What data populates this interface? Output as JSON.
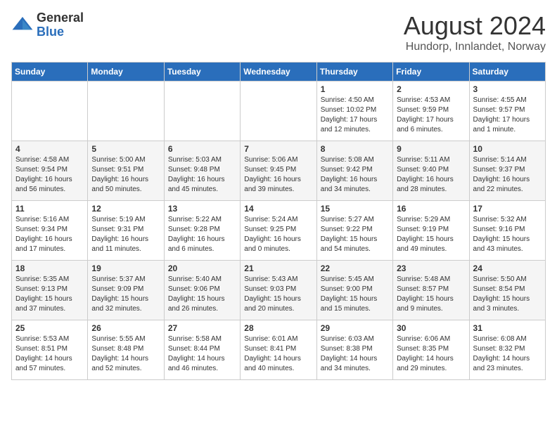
{
  "header": {
    "logo_general": "General",
    "logo_blue": "Blue",
    "month_year": "August 2024",
    "location": "Hundorp, Innlandet, Norway"
  },
  "days_of_week": [
    "Sunday",
    "Monday",
    "Tuesday",
    "Wednesday",
    "Thursday",
    "Friday",
    "Saturday"
  ],
  "weeks": [
    [
      {
        "day": "",
        "info": ""
      },
      {
        "day": "",
        "info": ""
      },
      {
        "day": "",
        "info": ""
      },
      {
        "day": "",
        "info": ""
      },
      {
        "day": "1",
        "info": "Sunrise: 4:50 AM\nSunset: 10:02 PM\nDaylight: 17 hours\nand 12 minutes."
      },
      {
        "day": "2",
        "info": "Sunrise: 4:53 AM\nSunset: 9:59 PM\nDaylight: 17 hours\nand 6 minutes."
      },
      {
        "day": "3",
        "info": "Sunrise: 4:55 AM\nSunset: 9:57 PM\nDaylight: 17 hours\nand 1 minute."
      }
    ],
    [
      {
        "day": "4",
        "info": "Sunrise: 4:58 AM\nSunset: 9:54 PM\nDaylight: 16 hours\nand 56 minutes."
      },
      {
        "day": "5",
        "info": "Sunrise: 5:00 AM\nSunset: 9:51 PM\nDaylight: 16 hours\nand 50 minutes."
      },
      {
        "day": "6",
        "info": "Sunrise: 5:03 AM\nSunset: 9:48 PM\nDaylight: 16 hours\nand 45 minutes."
      },
      {
        "day": "7",
        "info": "Sunrise: 5:06 AM\nSunset: 9:45 PM\nDaylight: 16 hours\nand 39 minutes."
      },
      {
        "day": "8",
        "info": "Sunrise: 5:08 AM\nSunset: 9:42 PM\nDaylight: 16 hours\nand 34 minutes."
      },
      {
        "day": "9",
        "info": "Sunrise: 5:11 AM\nSunset: 9:40 PM\nDaylight: 16 hours\nand 28 minutes."
      },
      {
        "day": "10",
        "info": "Sunrise: 5:14 AM\nSunset: 9:37 PM\nDaylight: 16 hours\nand 22 minutes."
      }
    ],
    [
      {
        "day": "11",
        "info": "Sunrise: 5:16 AM\nSunset: 9:34 PM\nDaylight: 16 hours\nand 17 minutes."
      },
      {
        "day": "12",
        "info": "Sunrise: 5:19 AM\nSunset: 9:31 PM\nDaylight: 16 hours\nand 11 minutes."
      },
      {
        "day": "13",
        "info": "Sunrise: 5:22 AM\nSunset: 9:28 PM\nDaylight: 16 hours\nand 6 minutes."
      },
      {
        "day": "14",
        "info": "Sunrise: 5:24 AM\nSunset: 9:25 PM\nDaylight: 16 hours\nand 0 minutes."
      },
      {
        "day": "15",
        "info": "Sunrise: 5:27 AM\nSunset: 9:22 PM\nDaylight: 15 hours\nand 54 minutes."
      },
      {
        "day": "16",
        "info": "Sunrise: 5:29 AM\nSunset: 9:19 PM\nDaylight: 15 hours\nand 49 minutes."
      },
      {
        "day": "17",
        "info": "Sunrise: 5:32 AM\nSunset: 9:16 PM\nDaylight: 15 hours\nand 43 minutes."
      }
    ],
    [
      {
        "day": "18",
        "info": "Sunrise: 5:35 AM\nSunset: 9:13 PM\nDaylight: 15 hours\nand 37 minutes."
      },
      {
        "day": "19",
        "info": "Sunrise: 5:37 AM\nSunset: 9:09 PM\nDaylight: 15 hours\nand 32 minutes."
      },
      {
        "day": "20",
        "info": "Sunrise: 5:40 AM\nSunset: 9:06 PM\nDaylight: 15 hours\nand 26 minutes."
      },
      {
        "day": "21",
        "info": "Sunrise: 5:43 AM\nSunset: 9:03 PM\nDaylight: 15 hours\nand 20 minutes."
      },
      {
        "day": "22",
        "info": "Sunrise: 5:45 AM\nSunset: 9:00 PM\nDaylight: 15 hours\nand 15 minutes."
      },
      {
        "day": "23",
        "info": "Sunrise: 5:48 AM\nSunset: 8:57 PM\nDaylight: 15 hours\nand 9 minutes."
      },
      {
        "day": "24",
        "info": "Sunrise: 5:50 AM\nSunset: 8:54 PM\nDaylight: 15 hours\nand 3 minutes."
      }
    ],
    [
      {
        "day": "25",
        "info": "Sunrise: 5:53 AM\nSunset: 8:51 PM\nDaylight: 14 hours\nand 57 minutes."
      },
      {
        "day": "26",
        "info": "Sunrise: 5:55 AM\nSunset: 8:48 PM\nDaylight: 14 hours\nand 52 minutes."
      },
      {
        "day": "27",
        "info": "Sunrise: 5:58 AM\nSunset: 8:44 PM\nDaylight: 14 hours\nand 46 minutes."
      },
      {
        "day": "28",
        "info": "Sunrise: 6:01 AM\nSunset: 8:41 PM\nDaylight: 14 hours\nand 40 minutes."
      },
      {
        "day": "29",
        "info": "Sunrise: 6:03 AM\nSunset: 8:38 PM\nDaylight: 14 hours\nand 34 minutes."
      },
      {
        "day": "30",
        "info": "Sunrise: 6:06 AM\nSunset: 8:35 PM\nDaylight: 14 hours\nand 29 minutes."
      },
      {
        "day": "31",
        "info": "Sunrise: 6:08 AM\nSunset: 8:32 PM\nDaylight: 14 hours\nand 23 minutes."
      }
    ]
  ]
}
